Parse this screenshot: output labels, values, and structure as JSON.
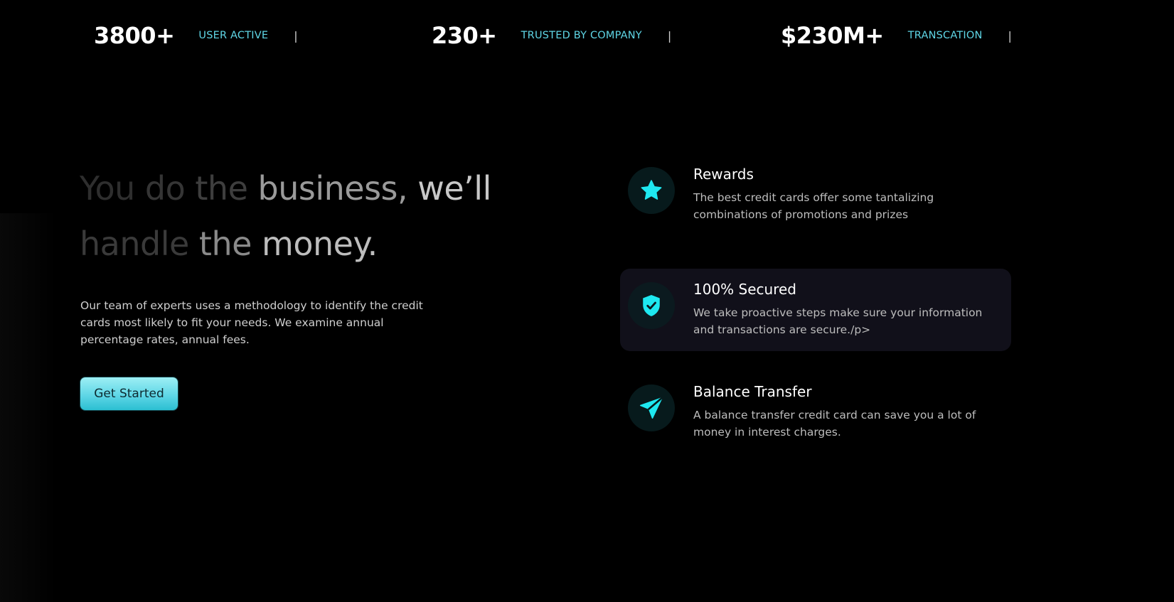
{
  "colors": {
    "background": "#000000",
    "accent": "#5fd6e6",
    "icon": "#1ee8f0",
    "card_active": "#11101a"
  },
  "stats": [
    {
      "value": "3800+",
      "label": "USER ACTIVE",
      "separator": "|"
    },
    {
      "value": "230+",
      "label": "TRUSTED BY COMPANY",
      "separator": "|"
    },
    {
      "value": "$230M+",
      "label": "TRANSCATION",
      "separator": "|"
    }
  ],
  "hero": {
    "headline_words": [
      "You",
      "do",
      "the",
      "business,",
      "we’ll",
      "handle",
      "the",
      "money."
    ],
    "headline_word_colors": [
      "#2e2e2e",
      "#353535",
      "#3e3e3e",
      "#9a9a9a",
      "#c8c8c8",
      "#3a3a3a",
      "#8a8a8a",
      "#bdbdbd"
    ],
    "description": "Our team of experts uses a methodology to identify the credit cards most likely to fit your needs. We examine annual percentage rates, annual fees.",
    "cta_label": "Get Started"
  },
  "features": [
    {
      "icon": "star-icon",
      "title": "Rewards",
      "description": "The best credit cards offer some tantalizing combinations of promotions and prizes",
      "active": false
    },
    {
      "icon": "shield-check-icon",
      "title": "100% Secured",
      "description": "We take proactive steps make sure your information and transactions are secure./p>",
      "active": true
    },
    {
      "icon": "send-icon",
      "title": "Balance Transfer",
      "description": "A balance transfer credit card can save you a lot of money in interest charges.",
      "active": false
    }
  ]
}
